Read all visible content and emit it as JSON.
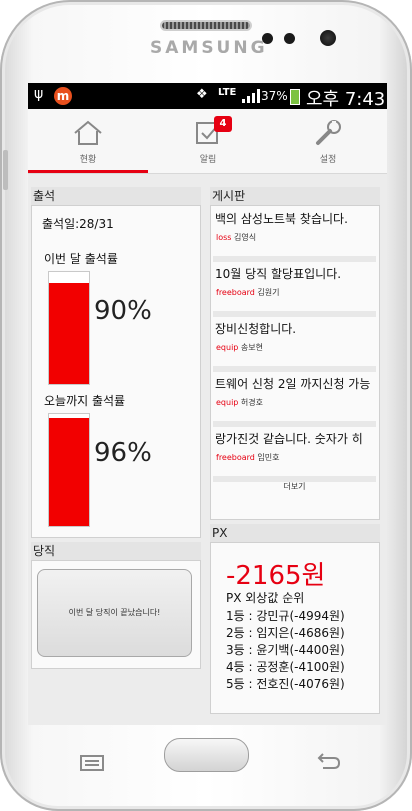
{
  "device": {
    "brand": "SAMSUNG"
  },
  "status_bar": {
    "battery": "37%",
    "network": "LTE",
    "time": "오후 7:43",
    "icons": [
      "usb-icon",
      "app-notification-icon",
      "vibrate-icon",
      "lte-icon",
      "signal-icon",
      "battery-icon"
    ]
  },
  "tabs": [
    {
      "label": "현황",
      "icon": "home-icon",
      "active": true
    },
    {
      "label": "알림",
      "icon": "checkbox-icon",
      "badge": "4",
      "active": false
    },
    {
      "label": "설정",
      "icon": "wrench-icon",
      "active": false
    }
  ],
  "attendance": {
    "title": "출석",
    "days": "출석일:28/31",
    "month_label": "이번 달 출석률",
    "month_value": "90%",
    "month_fraction": 0.9,
    "today_label": "오늘까지 출석률",
    "today_value": "96%",
    "today_fraction": 0.96,
    "bar_color": "#f20000"
  },
  "duty": {
    "title": "당직",
    "button_label": "이번 달 당직이 끝났습니다!"
  },
  "board": {
    "title": "게시판",
    "posts": [
      {
        "title": "백의 삼성노트북 찾습니다.",
        "category": "loss",
        "author": "김영식"
      },
      {
        "title": "10월 당직 할당표입니다.",
        "category": "freeboard",
        "author": "김원기"
      },
      {
        "title": "장비신청합니다.",
        "category": "equip",
        "author": "송보현"
      },
      {
        "title": "트웨어 신청 2일 까지신청 가능",
        "category": "equip",
        "author": "허경호"
      },
      {
        "title": "랑가진것 같습니다. 숫자가 히",
        "category": "freeboard",
        "author": "임민호"
      }
    ],
    "more_label": "더보기"
  },
  "px": {
    "title": "PX",
    "amount": "-2165원",
    "ranking_title": "PX 외상값 순위",
    "ranks": [
      "1등 : 강민규(-4994원)",
      "2등 : 임지은(-4686원)",
      "3등 : 윤기백(-4400원)",
      "4등 : 공정훈(-4100원)",
      "5등 : 전호진(-4076원)"
    ]
  },
  "colors": {
    "accent": "#e60012",
    "screen_bg": "#ececec",
    "status_bar_bg": "#000000"
  }
}
